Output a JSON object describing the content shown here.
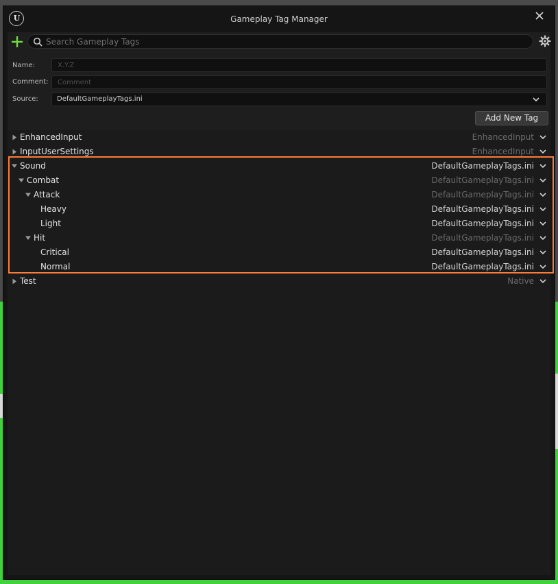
{
  "window": {
    "title": "Gameplay Tag Manager",
    "logo_text": "U"
  },
  "search": {
    "placeholder": "Search Gameplay Tags",
    "value": ""
  },
  "form": {
    "name_label": "Name:",
    "name_placeholder": "X.Y.Z",
    "comment_label": "Comment:",
    "comment_placeholder": "Comment",
    "source_label": "Source:",
    "source_value": "DefaultGameplayTags.ini"
  },
  "add_button_label": "Add New Tag",
  "colors": {
    "accent_add": "#6fdc3a",
    "highlight_border": "#ff7b3a",
    "source_dim": "#6a6a6a",
    "source_bright": "#d4d4d4"
  },
  "tree": [
    {
      "label": "EnhancedInput",
      "source": "EnhancedInput",
      "source_dim": true,
      "depth": 0,
      "arrow": "collapsed"
    },
    {
      "label": "InputUserSettings",
      "source": "EnhancedInput",
      "source_dim": true,
      "depth": 0,
      "arrow": "collapsed"
    },
    {
      "label": "Sound",
      "source": "DefaultGameplayTags.ini",
      "source_dim": false,
      "depth": 0,
      "arrow": "expanded"
    },
    {
      "label": "Combat",
      "source": "DefaultGameplayTags.ini",
      "source_dim": true,
      "depth": 1,
      "arrow": "expanded"
    },
    {
      "label": "Attack",
      "source": "DefaultGameplayTags.ini",
      "source_dim": true,
      "depth": 2,
      "arrow": "expanded"
    },
    {
      "label": "Heavy",
      "source": "DefaultGameplayTags.ini",
      "source_dim": false,
      "depth": 3,
      "arrow": "none"
    },
    {
      "label": "Light",
      "source": "DefaultGameplayTags.ini",
      "source_dim": false,
      "depth": 3,
      "arrow": "none"
    },
    {
      "label": "Hit",
      "source": "DefaultGameplayTags.ini",
      "source_dim": true,
      "depth": 2,
      "arrow": "expanded"
    },
    {
      "label": "Critical",
      "source": "DefaultGameplayTags.ini",
      "source_dim": false,
      "depth": 3,
      "arrow": "none"
    },
    {
      "label": "Normal",
      "source": "DefaultGameplayTags.ini",
      "source_dim": false,
      "depth": 3,
      "arrow": "none"
    },
    {
      "label": "Test",
      "source": "Native",
      "source_dim": true,
      "depth": 0,
      "arrow": "collapsed"
    }
  ],
  "highlighted_rows": [
    "Sound",
    "Combat",
    "Attack",
    "Heavy",
    "Light",
    "Hit",
    "Critical",
    "Normal"
  ]
}
